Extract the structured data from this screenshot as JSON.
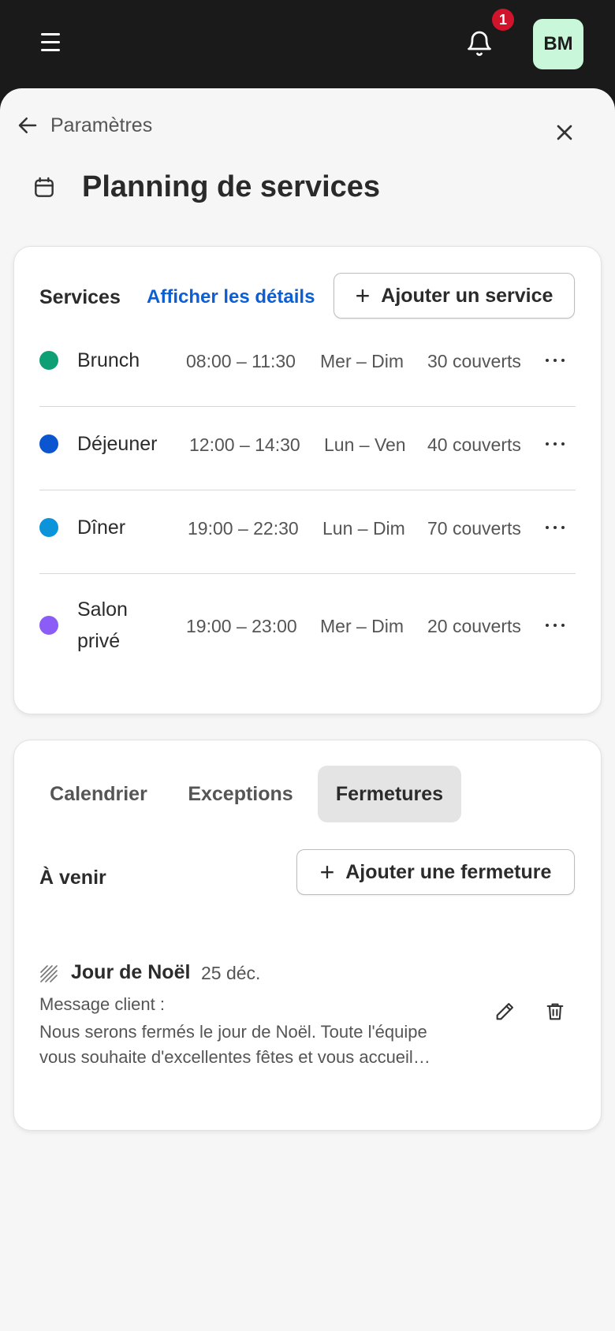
{
  "topbar": {
    "menu_icon": "hamburger-icon",
    "bell_icon": "bell-icon",
    "notification_count": "1",
    "avatar_initials": "BM",
    "avatar_color": "#c9f7d9",
    "badge_color": "#d0142c"
  },
  "nav": {
    "back_label": "Paramètres",
    "close_icon": "close-icon"
  },
  "page": {
    "title": "Planning de services",
    "title_icon": "calendar-icon"
  },
  "services": {
    "label": "Services",
    "details_link": "Afficher les détails",
    "add_button": "Ajouter un service",
    "link_color": "#0a5fd6",
    "items": [
      {
        "name": "Brunch",
        "hours": "08:00 – 11:30",
        "days": "Mer – Dim",
        "covers": "30 couverts",
        "color": "#0f9f74"
      },
      {
        "name": "Déjeuner",
        "hours": "12:00 – 14:30",
        "days": "Lun – Ven",
        "covers": "40 couverts",
        "color": "#0b55d0"
      },
      {
        "name": "Dîner",
        "hours": "19:00 – 22:30",
        "days": "Lun – Dim",
        "covers": "70 couverts",
        "color": "#0b94d9"
      },
      {
        "name_line1": "Salon",
        "name_line2": "privé",
        "hours": "19:00 – 23:00",
        "days": "Mer – Dim",
        "covers": "20 couverts",
        "color": "#8b5cf6"
      }
    ]
  },
  "tabs": {
    "items": [
      "Calendrier",
      "Exceptions",
      "Fermetures"
    ],
    "active": "Fermetures"
  },
  "closures": {
    "section_label": "À venir",
    "add_button": "Ajouter une fermeture",
    "items": [
      {
        "title": "Jour de Noël",
        "date": "25 déc.",
        "message_label": "Message client :",
        "message": "Nous serons fermés le jour de Noël. Toute l'équipe vous souhaite d'excellentes fêtes et vous accueil…"
      }
    ]
  }
}
